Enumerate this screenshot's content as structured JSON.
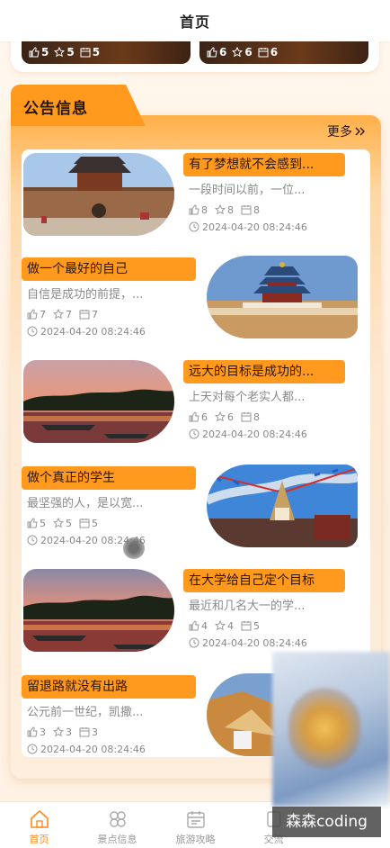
{
  "header": {
    "title": "首页"
  },
  "prev_cards": [
    {
      "likes": "5",
      "stars": "5",
      "views": "5"
    },
    {
      "likes": "6",
      "stars": "6",
      "views": "6"
    }
  ],
  "section": {
    "title": "公告信息",
    "more": "更多"
  },
  "items": [
    {
      "title": "有了梦想就不会感到...",
      "desc": "一段时间以前，一位...",
      "likes": "8",
      "stars": "8",
      "views": "8",
      "time": "2024-04-20 08:24:46"
    },
    {
      "title": "做一个最好的自己",
      "desc": "自信是成功的前提，...",
      "likes": "7",
      "stars": "7",
      "views": "7",
      "time": "2024-04-20 08:24:46"
    },
    {
      "title": "远大的目标是成功的...",
      "desc": "上天对每个老实人都...",
      "likes": "6",
      "stars": "6",
      "views": "8",
      "time": "2024-04-20 08:24:46"
    },
    {
      "title": "做个真正的学生",
      "desc": "最坚强的人，是以宽...",
      "likes": "5",
      "stars": "5",
      "views": "5",
      "time": "2024-04-20 08:24:46"
    },
    {
      "title": "在大学给自己定个目标",
      "desc": "最近和几名大一的学...",
      "likes": "4",
      "stars": "4",
      "views": "5",
      "time": "2024-04-20 08:24:46"
    },
    {
      "title": "留退路就没有出路",
      "desc": "公元前一世纪，凯撒...",
      "likes": "3",
      "stars": "3",
      "views": "3",
      "time": "2024-04-20 08:24:46"
    }
  ],
  "nav": [
    {
      "label": "首页"
    },
    {
      "label": "景点信息"
    },
    {
      "label": "旅游攻略"
    },
    {
      "label": "交流"
    }
  ],
  "watermark": "森森coding",
  "colors": {
    "accent": "#ff9a1e",
    "active": "#ff8a1e"
  }
}
